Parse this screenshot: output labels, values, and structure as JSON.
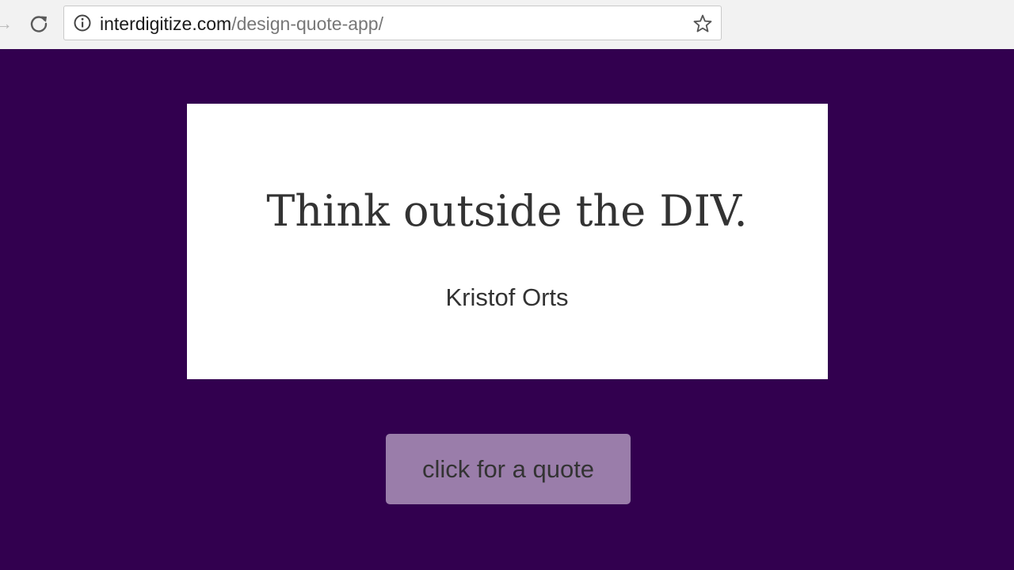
{
  "browser": {
    "url_host": "interdigitize.com",
    "url_path": "/design-quote-app/",
    "icons": {
      "forward": "forward-arrow-icon",
      "reload": "reload-icon",
      "info": "info-icon",
      "bookmark": "star-icon"
    }
  },
  "quote": {
    "text": "Think outside the DIV.",
    "author": "Kristof Orts"
  },
  "button": {
    "label": "click for a quote"
  },
  "colors": {
    "page_background": "#32004f",
    "card_background": "#ffffff",
    "button_background": "#9a7daa",
    "text": "#333333"
  }
}
